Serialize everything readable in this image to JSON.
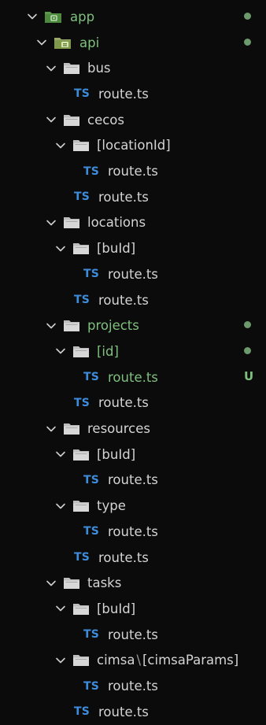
{
  "colors": {
    "background": "#0b0b0b",
    "text": "#d4d4d4",
    "modified_text": "#7fc07f",
    "ts_icon": "#3d8ddc",
    "folder_icon": "#d7d7d7",
    "special_folder_icon": "#5a9a4a",
    "git_dot": "#6c9a6c"
  },
  "tree": [
    {
      "type": "folder",
      "depth": 0,
      "label": "app",
      "icon": "app-folder-icon",
      "expanded": true,
      "modified": true,
      "badge": "dot"
    },
    {
      "type": "folder",
      "depth": 1,
      "label": "api",
      "icon": "api-folder-icon",
      "expanded": true,
      "modified": true,
      "badge": "dot"
    },
    {
      "type": "folder",
      "depth": 2,
      "label": "bus",
      "icon": "folder-icon",
      "expanded": true
    },
    {
      "type": "file",
      "depth": 3,
      "label": "route.ts",
      "icon": "typescript-icon",
      "icon_text": "TS"
    },
    {
      "type": "folder",
      "depth": 2,
      "label": "cecos",
      "icon": "folder-icon",
      "expanded": true
    },
    {
      "type": "folder",
      "depth": 3,
      "label": "[locationId]",
      "icon": "folder-icon",
      "expanded": true
    },
    {
      "type": "file",
      "depth": 4,
      "label": "route.ts",
      "icon": "typescript-icon",
      "icon_text": "TS"
    },
    {
      "type": "file",
      "depth": 3,
      "label": "route.ts",
      "icon": "typescript-icon",
      "icon_text": "TS"
    },
    {
      "type": "folder",
      "depth": 2,
      "label": "locations",
      "icon": "folder-icon",
      "expanded": true
    },
    {
      "type": "folder",
      "depth": 3,
      "label": "[buId]",
      "icon": "folder-icon",
      "expanded": true
    },
    {
      "type": "file",
      "depth": 4,
      "label": "route.ts",
      "icon": "typescript-icon",
      "icon_text": "TS"
    },
    {
      "type": "file",
      "depth": 3,
      "label": "route.ts",
      "icon": "typescript-icon",
      "icon_text": "TS"
    },
    {
      "type": "folder",
      "depth": 2,
      "label": "projects",
      "icon": "folder-icon",
      "expanded": true,
      "modified": true,
      "badge": "dot"
    },
    {
      "type": "folder",
      "depth": 3,
      "label": "[id]",
      "icon": "folder-icon",
      "expanded": true,
      "modified": true,
      "badge": "dot"
    },
    {
      "type": "file",
      "depth": 4,
      "label": "route.ts",
      "icon": "typescript-icon",
      "icon_text": "TS",
      "modified": true,
      "badge": "U"
    },
    {
      "type": "file",
      "depth": 3,
      "label": "route.ts",
      "icon": "typescript-icon",
      "icon_text": "TS"
    },
    {
      "type": "folder",
      "depth": 2,
      "label": "resources",
      "icon": "folder-icon",
      "expanded": true
    },
    {
      "type": "folder",
      "depth": 3,
      "label": "[buId]",
      "icon": "folder-icon",
      "expanded": true
    },
    {
      "type": "file",
      "depth": 4,
      "label": "route.ts",
      "icon": "typescript-icon",
      "icon_text": "TS"
    },
    {
      "type": "folder",
      "depth": 3,
      "label": "type",
      "icon": "folder-icon",
      "expanded": true
    },
    {
      "type": "file",
      "depth": 4,
      "label": "route.ts",
      "icon": "typescript-icon",
      "icon_text": "TS"
    },
    {
      "type": "file",
      "depth": 3,
      "label": "route.ts",
      "icon": "typescript-icon",
      "icon_text": "TS"
    },
    {
      "type": "folder",
      "depth": 2,
      "label": "tasks",
      "icon": "folder-icon",
      "expanded": true
    },
    {
      "type": "folder",
      "depth": 3,
      "label": "[buId]",
      "icon": "folder-icon",
      "expanded": true
    },
    {
      "type": "file",
      "depth": 4,
      "label": "route.ts",
      "icon": "typescript-icon",
      "icon_text": "TS"
    },
    {
      "type": "folder",
      "depth": 3,
      "label": "cimsa",
      "label_sep": "\\",
      "label_suffix": "[cimsaParams]",
      "icon": "folder-icon",
      "expanded": true
    },
    {
      "type": "file",
      "depth": 4,
      "label": "route.ts",
      "icon": "typescript-icon",
      "icon_text": "TS"
    },
    {
      "type": "file",
      "depth": 3,
      "label": "route.ts",
      "icon": "typescript-icon",
      "icon_text": "TS"
    }
  ]
}
